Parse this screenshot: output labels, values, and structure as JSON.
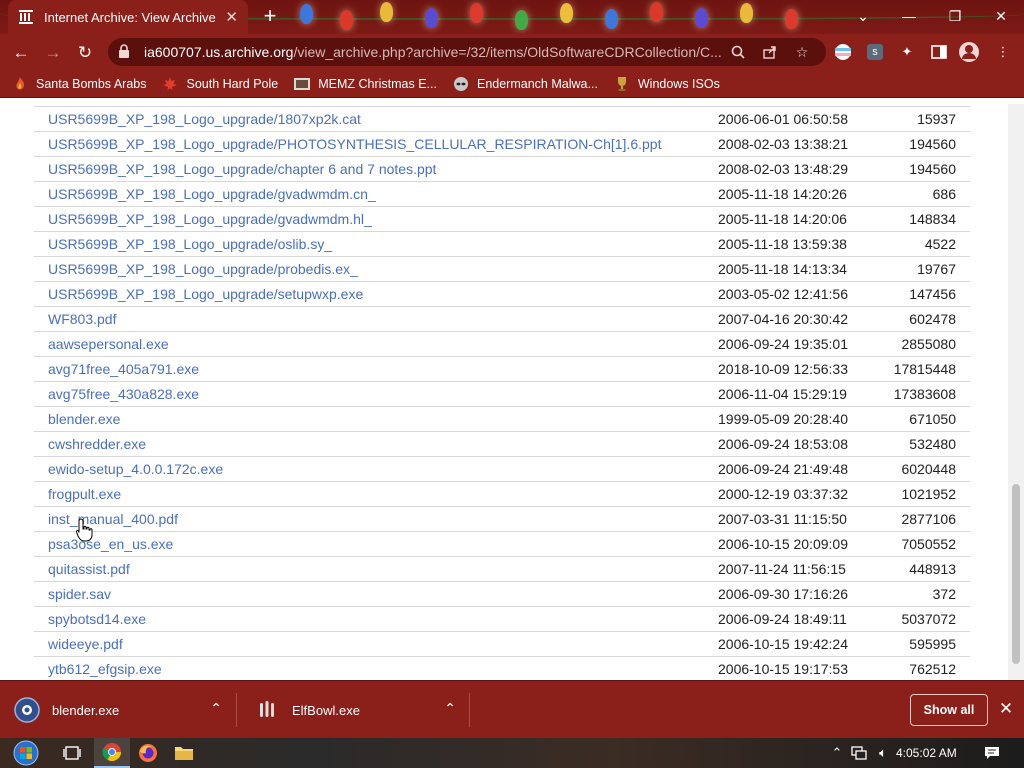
{
  "browser": {
    "tab_title": "Internet Archive: View Archive",
    "url_host": "ia600707.us.archive.org",
    "url_path": "/view_archive.php?archive=/32/items/OldSoftwareCDRCollection/C...",
    "bookmarks": [
      {
        "label": "Santa Bombs Arabs",
        "icon": "fire-icon"
      },
      {
        "label": "South Hard Pole",
        "icon": "maple-leaf-icon"
      },
      {
        "label": "MEMZ Christmas E...",
        "icon": "video-thumbnail-icon"
      },
      {
        "label": "Endermanch Malwa...",
        "icon": "raccoon-icon"
      },
      {
        "label": "Windows ISOs",
        "icon": "trophy-icon"
      }
    ]
  },
  "files": [
    {
      "name": "USR5699B_XP_198_Logo_upgrade/1807xp2k.cat",
      "date": "2006-06-01 06:50:58",
      "size": "15937"
    },
    {
      "name": "USR5699B_XP_198_Logo_upgrade/PHOTOSYNTHESIS_CELLULAR_RESPIRATION-Ch[1].6.ppt",
      "date": "2008-02-03 13:38:21",
      "size": "194560"
    },
    {
      "name": "USR5699B_XP_198_Logo_upgrade/chapter 6 and 7 notes.ppt",
      "date": "2008-02-03 13:48:29",
      "size": "194560"
    },
    {
      "name": "USR5699B_XP_198_Logo_upgrade/gvadwmdm.cn_",
      "date": "2005-11-18 14:20:26",
      "size": "686"
    },
    {
      "name": "USR5699B_XP_198_Logo_upgrade/gvadwmdm.hl_",
      "date": "2005-11-18 14:20:06",
      "size": "148834"
    },
    {
      "name": "USR5699B_XP_198_Logo_upgrade/oslib.sy_",
      "date": "2005-11-18 13:59:38",
      "size": "4522"
    },
    {
      "name": "USR5699B_XP_198_Logo_upgrade/probedis.ex_",
      "date": "2005-11-18 14:13:34",
      "size": "19767"
    },
    {
      "name": "USR5699B_XP_198_Logo_upgrade/setupwxp.exe",
      "date": "2003-05-02 12:41:56",
      "size": "147456"
    },
    {
      "name": "WF803.pdf",
      "date": "2007-04-16 20:30:42",
      "size": "602478"
    },
    {
      "name": "aawsepersonal.exe",
      "date": "2006-09-24 19:35:01",
      "size": "2855080"
    },
    {
      "name": "avg71free_405a791.exe",
      "date": "2018-10-09 12:56:33",
      "size": "17815448"
    },
    {
      "name": "avg75free_430a828.exe",
      "date": "2006-11-04 15:29:19",
      "size": "17383608"
    },
    {
      "name": "blender.exe",
      "date": "1999-05-09 20:28:40",
      "size": "671050"
    },
    {
      "name": "cwshredder.exe",
      "date": "2006-09-24 18:53:08",
      "size": "532480"
    },
    {
      "name": "ewido-setup_4.0.0.172c.exe",
      "date": "2006-09-24 21:49:48",
      "size": "6020448"
    },
    {
      "name": "frogpult.exe",
      "date": "2000-12-19 03:37:32",
      "size": "1021952"
    },
    {
      "name": "inst_manual_400.pdf",
      "date": "2007-03-31 11:15:50",
      "size": "2877106"
    },
    {
      "name": "psa3ose_en_us.exe",
      "date": "2006-10-15 20:09:09",
      "size": "7050552"
    },
    {
      "name": "quitassist.pdf",
      "date": "2007-11-24 11:56:15",
      "size": "448913"
    },
    {
      "name": "spider.sav",
      "date": "2006-09-30 17:16:26",
      "size": "372"
    },
    {
      "name": "spybotsd14.exe",
      "date": "2006-09-24 18:49:11",
      "size": "5037072"
    },
    {
      "name": "wideeye.pdf",
      "date": "2006-10-15 19:42:24",
      "size": "595995"
    },
    {
      "name": "ytb612_efgsip.exe",
      "date": "2006-10-15 19:17:53",
      "size": "762512"
    }
  ],
  "downloads": {
    "items": [
      {
        "name": "blender.exe",
        "icon": "blender-app-icon"
      },
      {
        "name": "ElfBowl.exe",
        "icon": "elfbowl-app-icon"
      }
    ],
    "show_all_label": "Show all"
  },
  "taskbar": {
    "clock": "4:05:02 AM"
  },
  "colors": {
    "chrome_red": "#8b1f1a",
    "link_blue": "#4a6fc0"
  }
}
